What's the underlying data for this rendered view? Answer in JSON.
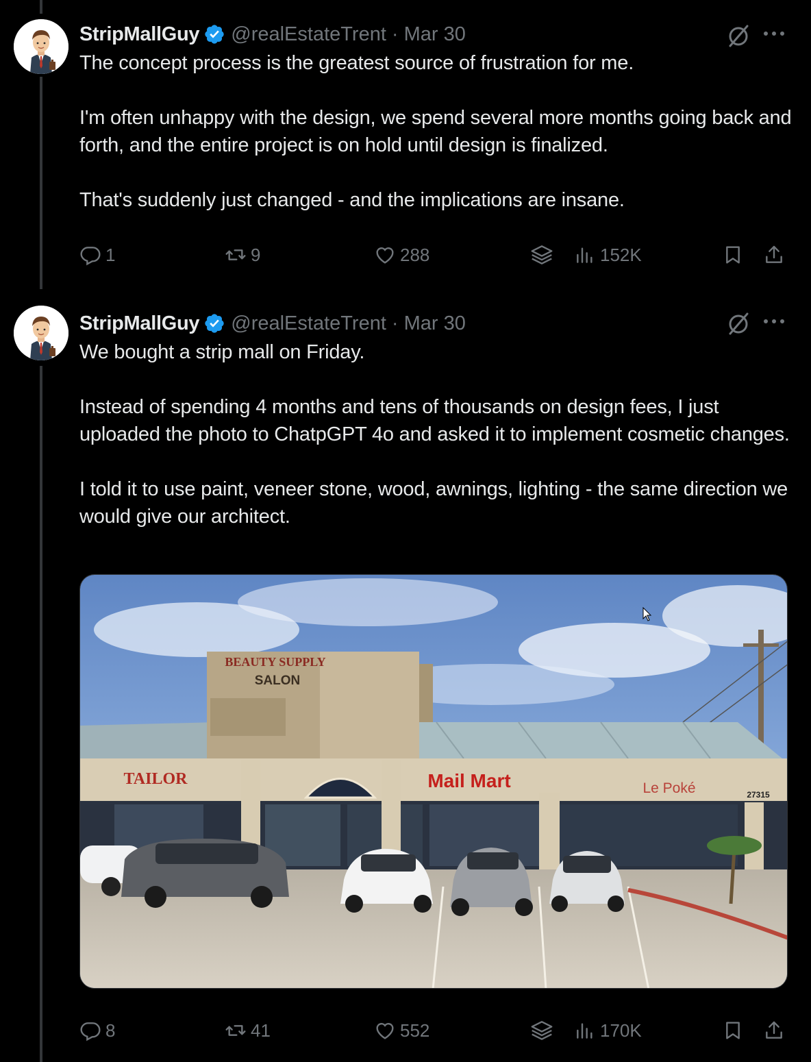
{
  "tweets": [
    {
      "author": {
        "display_name": "StripMallGuy",
        "handle": "@realEstateTrent",
        "separator": "·",
        "date": "Mar 30"
      },
      "paragraphs": [
        "The concept process is the greatest source of frustration for me.",
        "I'm often unhappy with the design, we spend several more months going back and forth, and the entire project is on hold until design is finalized.",
        "That's suddenly just changed - and the implications are insane."
      ],
      "stats": {
        "replies": "1",
        "retweets": "9",
        "likes": "288",
        "views": "152K"
      }
    },
    {
      "author": {
        "display_name": "StripMallGuy",
        "handle": "@realEstateTrent",
        "separator": "·",
        "date": "Mar 30"
      },
      "paragraphs": [
        "We bought a strip mall on Friday.",
        "Instead of spending 4 months and tens of thousands on design fees, I just uploaded the photo to ChatpGPT 4o and asked it to implement cosmetic changes.",
        "I told it to use paint, veneer stone, wood, awnings, lighting - the same direction we would give our architect."
      ],
      "media": {
        "signs": {
          "beauty": "BEAUTY SUPPLY",
          "salon": "SALON",
          "tailor": "TAILOR",
          "mail": "Mail Mart",
          "poke": "Le Poké",
          "address": "27315"
        }
      },
      "stats": {
        "replies": "8",
        "retweets": "41",
        "likes": "552",
        "views": "170K"
      }
    }
  ],
  "colors": {
    "background": "#000000",
    "text": "#e7e9ea",
    "muted": "#71767b",
    "verified": "#1d9bf0",
    "thread_line": "#333639"
  }
}
